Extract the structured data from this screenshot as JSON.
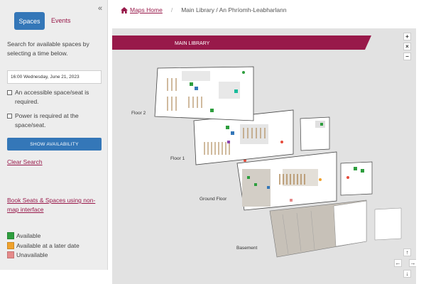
{
  "sidebar": {
    "collapse_icon": "«",
    "tabs": [
      {
        "label": "Spaces"
      },
      {
        "label": "Events"
      }
    ],
    "intro": "Search for available spaces by selecting a time below.",
    "date_value": "16:00 Wednesday, June 21, 2023",
    "accessible_label": "An accessible space/seat is required.",
    "power_label": "Power is required at the space/seat.",
    "show_availability": "SHOW AVAILABILITY",
    "clear_search": "Clear Search",
    "book_link": "Book Seats & Spaces using non-map interface",
    "legend": [
      {
        "label": "Available",
        "color": "#2e9e3e"
      },
      {
        "label": "Available at a later date",
        "color": "#f0a22c"
      },
      {
        "label": "Unavailable",
        "color": "#e58a8a"
      }
    ]
  },
  "breadcrumb": {
    "home": "Maps Home",
    "separator": "/",
    "current": "Main Library / An Phríomh-Leabharlann"
  },
  "map": {
    "banner": "MAIN LIBRARY",
    "floors": [
      "Floor 2",
      "Floor 1",
      "Ground Floor",
      "Basement"
    ],
    "zoom_in": "+",
    "zoom_reset": "×",
    "zoom_out": "−",
    "pan_up": "↑",
    "pan_left": "←",
    "pan_right": "→",
    "pan_down": "↓",
    "brand_color": "#98194a"
  }
}
